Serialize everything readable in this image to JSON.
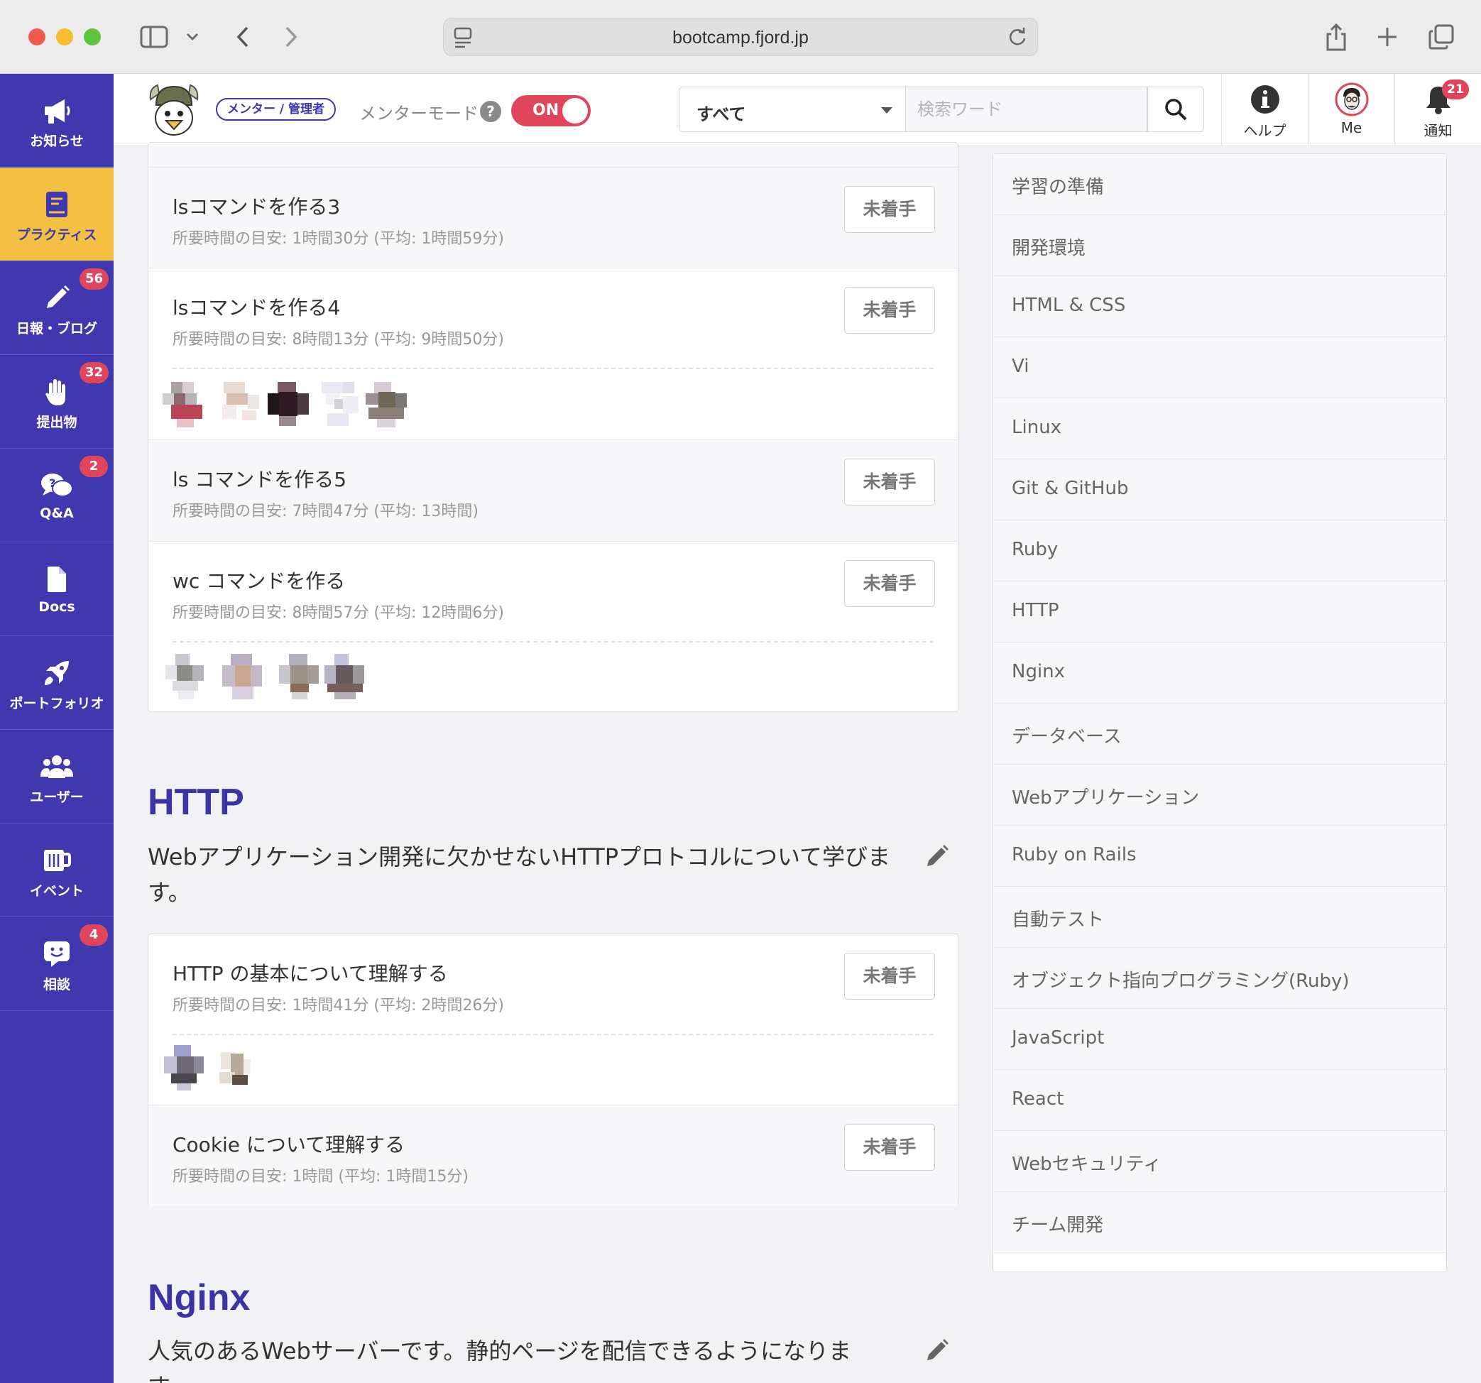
{
  "browser": {
    "url": "bootcamp.fjord.jp"
  },
  "sidebar": {
    "items": [
      {
        "label": "お知らせ",
        "icon": "megaphone-icon",
        "badge": ""
      },
      {
        "label": "プラクティス",
        "icon": "book-icon",
        "badge": "",
        "active": true
      },
      {
        "label": "日報・ブログ",
        "icon": "pencil-icon",
        "badge": "56"
      },
      {
        "label": "提出物",
        "icon": "hand-icon",
        "badge": "32"
      },
      {
        "label": "Q&A",
        "icon": "question-bubble-icon",
        "badge": "2"
      },
      {
        "label": "Docs",
        "icon": "document-icon",
        "badge": ""
      },
      {
        "label": "ポートフォリオ",
        "icon": "rocket-icon",
        "badge": ""
      },
      {
        "label": "ユーザー",
        "icon": "users-icon",
        "badge": ""
      },
      {
        "label": "イベント",
        "icon": "mug-icon",
        "badge": ""
      },
      {
        "label": "相談",
        "icon": "smile-bubble-icon",
        "badge": "4"
      }
    ]
  },
  "header": {
    "role_badge": "メンター / 管理者",
    "mentor_mode_label": "メンターモード",
    "help_mark": "?",
    "toggle_label": "ON",
    "search_scope": "すべて",
    "search_placeholder": "検索ワード",
    "help_label": "ヘルプ",
    "me_label": "Me",
    "notifications_label": "通知",
    "notifications_count": "21"
  },
  "practices_top": [
    {
      "title": "lsコマンドを作る3",
      "time": "所要時間の目安: 1時間30分 (平均: 1時間59分)",
      "status": "未着手"
    },
    {
      "title": "lsコマンドを作る4",
      "time": "所要時間の目安: 8時間13分 (平均: 9時間50分)",
      "status": "未着手"
    },
    {
      "title": "ls コマンドを作る5",
      "time": "所要時間の目安: 7時間47分 (平均: 13時間)",
      "status": "未着手"
    },
    {
      "title": "wc コマンドを作る",
      "time": "所要時間の目安: 8時間57分 (平均: 12時間6分)",
      "status": "未着手"
    }
  ],
  "http_section": {
    "title": "HTTP",
    "description": "Webアプリケーション開発に欠かせないHTTPプロトコルについて学びます。",
    "practices": [
      {
        "title": "HTTP の基本について理解する",
        "time": "所要時間の目安: 1時間41分 (平均: 2時間26分)",
        "status": "未着手"
      },
      {
        "title": "Cookie について理解する",
        "time": "所要時間の目安: 1時間 (平均: 1時間15分)",
        "status": "未着手"
      }
    ]
  },
  "nginx_section": {
    "title": "Nginx",
    "description": "人気のあるWebサーバーです。静的ページを配信できるようになります。"
  },
  "categories": [
    "学習の準備",
    "開発環境",
    "HTML & CSS",
    "Vi",
    "Linux",
    "Git & GitHub",
    "Ruby",
    "HTTP",
    "Nginx",
    "データベース",
    "Webアプリケーション",
    "Ruby on Rails",
    "自動テスト",
    "オブジェクト指向プログラミング(Ruby)",
    "JavaScript",
    "React",
    "Webセキュリティ",
    "チーム開発"
  ]
}
